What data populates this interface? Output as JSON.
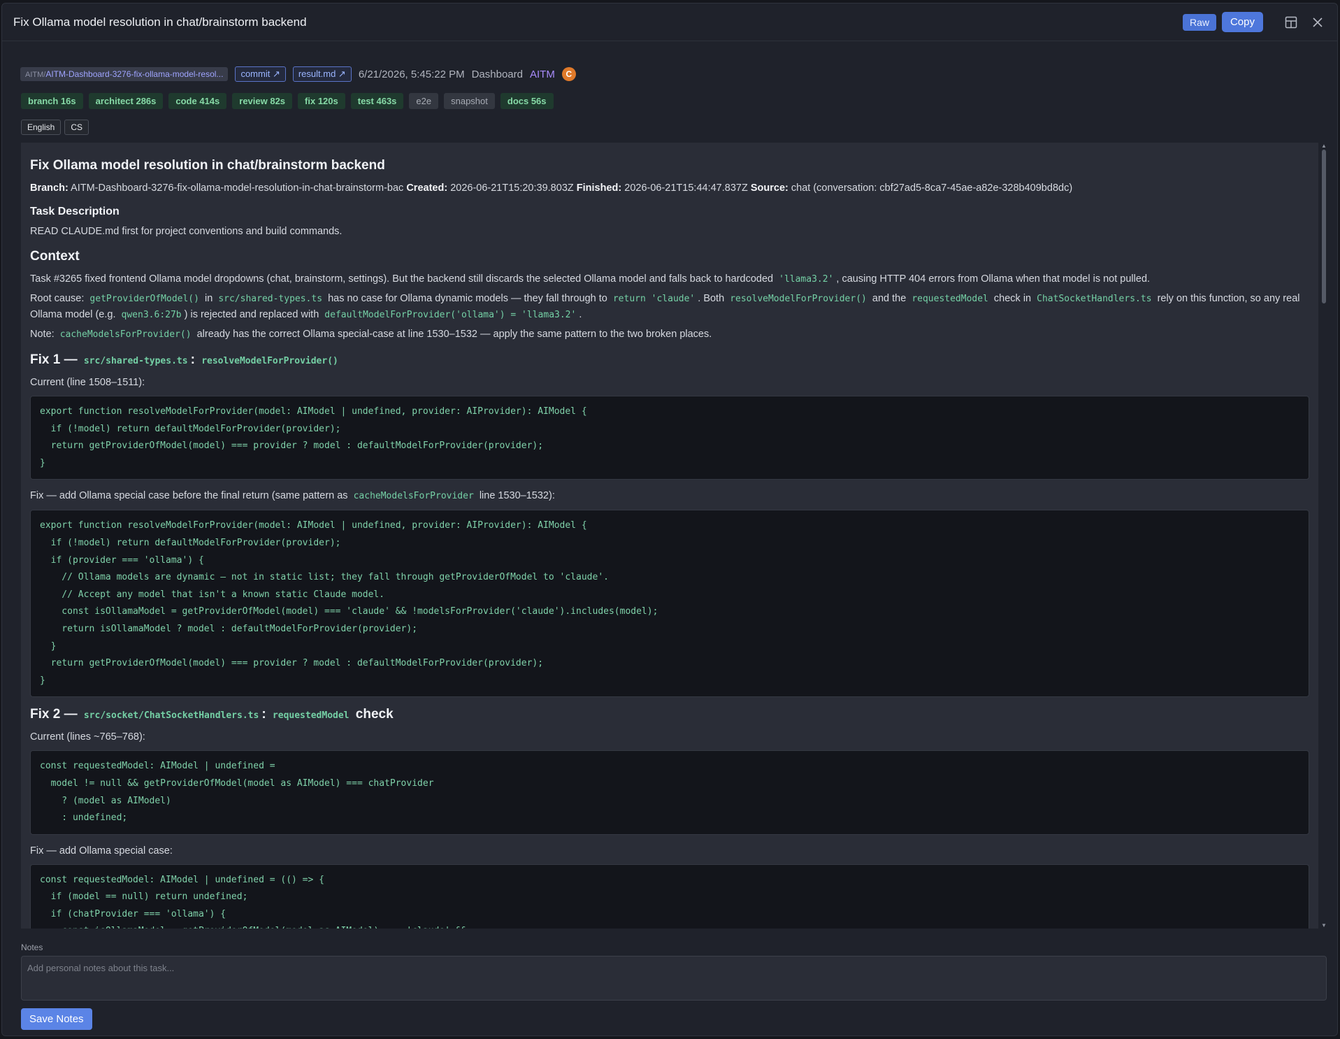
{
  "header": {
    "title": "Fix Ollama model resolution in chat/brainstorm backend",
    "raw_label": "Raw",
    "copy_label": "Copy"
  },
  "meta": {
    "branch_prefix": "AITM/",
    "branch": "AITM-Dashboard-3276-fix-ollama-model-resol...",
    "commit_label": "commit ↗",
    "result_label": "result.md ↗",
    "date": "6/21/2026, 5:45:22 PM",
    "dashboard": "Dashboard",
    "project": "AITM",
    "avatar": "C"
  },
  "stages": [
    {
      "label": "branch 16s",
      "done": true
    },
    {
      "label": "architect 286s",
      "done": true
    },
    {
      "label": "code 414s",
      "done": true
    },
    {
      "label": "review 82s",
      "done": true
    },
    {
      "label": "fix 120s",
      "done": true
    },
    {
      "label": "test 463s",
      "done": true
    },
    {
      "label": "e2e",
      "done": false
    },
    {
      "label": "snapshot",
      "done": false
    },
    {
      "label": "docs 56s",
      "done": true
    }
  ],
  "langs": [
    "English",
    "CS"
  ],
  "doc": {
    "title": "Fix Ollama model resolution in chat/brainstorm backend",
    "branch_label": "Branch:",
    "branch_value": "AITM-Dashboard-3276-fix-ollama-model-resolution-in-chat-brainstorm-bac",
    "created_label": "Created:",
    "created_value": "2026-06-21T15:20:39.803Z",
    "finished_label": "Finished:",
    "finished_value": "2026-06-21T15:44:47.837Z",
    "source_label": "Source:",
    "source_value": "chat (conversation: cbf27ad5-8ca7-45ae-a82e-328b409bd8dc)",
    "task_heading": "Task Description",
    "task_text": "READ CLAUDE.md first for project conventions and build commands.",
    "context_heading": "Context",
    "context_p1_a": "Task #3265 fixed frontend Ollama model dropdowns (chat, brainstorm, settings). But the backend still discards the selected Ollama model and falls back to hardcoded",
    "context_p1_code": "'llama3.2'",
    "context_p1_b": ", causing HTTP 404 errors from Ollama when that model is not pulled.",
    "root_a": "Root cause:",
    "root_code1": "getProviderOfModel()",
    "root_in": "in",
    "root_code2": "src/shared-types.ts",
    "root_b": "has no case for Ollama dynamic models — they fall through to",
    "root_code3": "return 'claude'",
    "root_c": ". Both",
    "root_code4": "resolveModelForProvider()",
    "root_and": "and the",
    "root_code5": "requestedModel",
    "root_check": "check in",
    "root_code6": "ChatSocketHandlers.ts",
    "root_d": "rely on this function, so any real Ollama model (e.g.",
    "root_code7": "qwen3.6:27b",
    "root_e": ") is rejected and replaced with",
    "root_code8": "defaultModelForProvider('ollama') = 'llama3.2'",
    "root_f": ".",
    "note_a": "Note:",
    "note_code": "cacheModelsForProvider()",
    "note_b": "already has the correct Ollama special-case at line 1530–1532 — apply the same pattern to the two broken places.",
    "fix1_prefix": "Fix 1 —",
    "fix1_code1": "src/shared-types.ts",
    "fix1_colon": ":",
    "fix1_code2": "resolveModelForProvider()",
    "fix1_current": "Current (line 1508–1511):",
    "fix1_code_current": "export function resolveModelForProvider(model: AIModel | undefined, provider: AIProvider): AIModel {\n  if (!model) return defaultModelForProvider(provider);\n  return getProviderOfModel(model) === provider ? model : defaultModelForProvider(provider);\n}",
    "fix1_fix_a": "Fix — add Ollama special case before the final return (same pattern as",
    "fix1_fix_code": "cacheModelsForProvider",
    "fix1_fix_b": "line 1530–1532):",
    "fix1_code_fixed": "export function resolveModelForProvider(model: AIModel | undefined, provider: AIProvider): AIModel {\n  if (!model) return defaultModelForProvider(provider);\n  if (provider === 'ollama') {\n    // Ollama models are dynamic — not in static list; they fall through getProviderOfModel to 'claude'.\n    // Accept any model that isn't a known static Claude model.\n    const isOllamaModel = getProviderOfModel(model) === 'claude' && !modelsForProvider('claude').includes(model);\n    return isOllamaModel ? model : defaultModelForProvider(provider);\n  }\n  return getProviderOfModel(model) === provider ? model : defaultModelForProvider(provider);\n}",
    "fix2_prefix": "Fix 2 —",
    "fix2_code1": "src/socket/ChatSocketHandlers.ts",
    "fix2_colon": ":",
    "fix2_code2": "requestedModel",
    "fix2_check": "check",
    "fix2_current": "Current (lines ~765–768):",
    "fix2_code_current": "const requestedModel: AIModel | undefined =\n  model != null && getProviderOfModel(model as AIModel) === chatProvider\n    ? (model as AIModel)\n    : undefined;",
    "fix2_fix": "Fix — add Ollama special case:",
    "fix2_code_fixed": "const requestedModel: AIModel | undefined = (() => {\n  if (model == null) return undefined;\n  if (chatProvider === 'ollama') {\n    const isOllamaModel = getProviderOfModel(model as AIModel) === 'claude' &&"
  },
  "notes": {
    "label": "Notes",
    "placeholder": "Add personal notes about this task...",
    "save_label": "Save Notes"
  }
}
